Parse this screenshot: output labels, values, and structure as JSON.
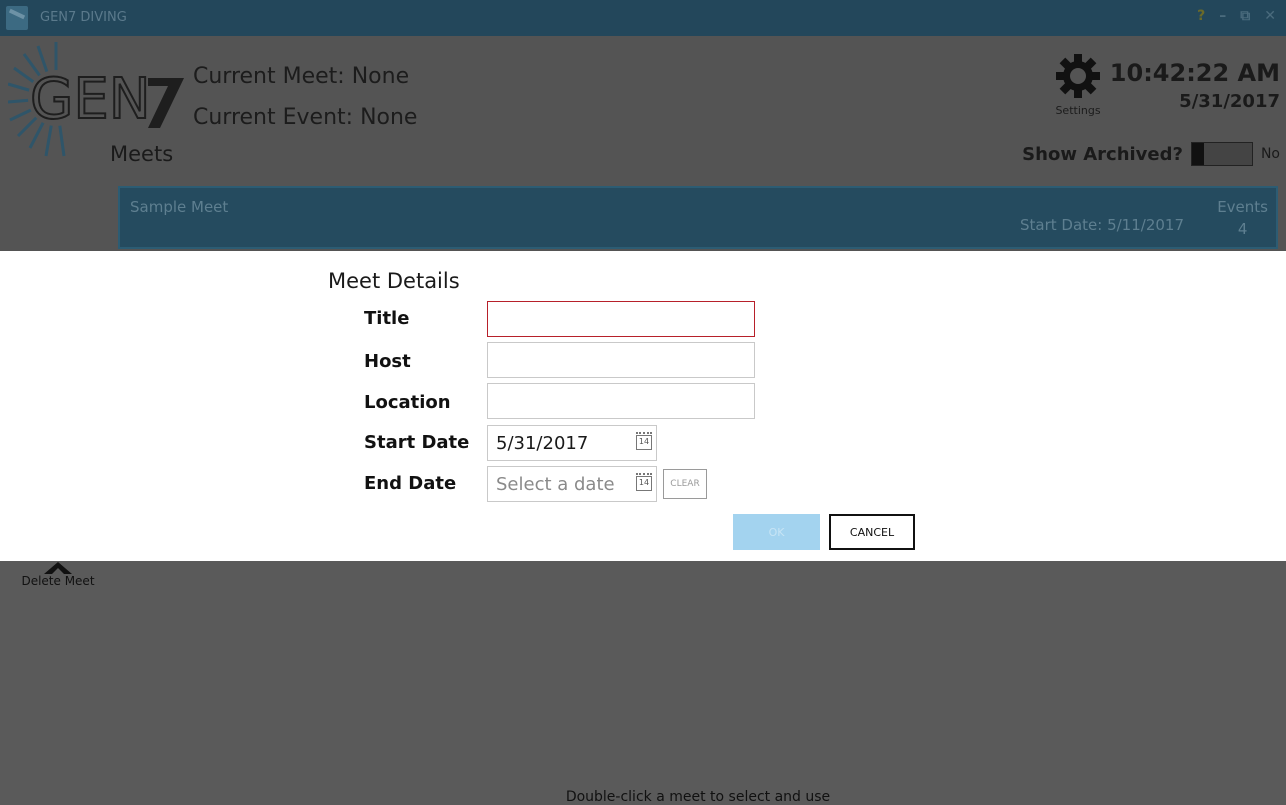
{
  "window": {
    "title": "GEN7 DIVING",
    "controls": {
      "help": "?",
      "minimize": "–",
      "restore": "⧉",
      "close": "✕"
    }
  },
  "header": {
    "current_meet_label": "Current Meet:",
    "current_meet_value": "None",
    "current_event_label": "Current Event:",
    "current_event_value": "None",
    "settings_label": "Settings",
    "time": "10:42:22 AM",
    "date": "5/31/2017"
  },
  "meets": {
    "section_title": "Meets",
    "show_archived_label": "Show Archived?",
    "show_archived_value": "No",
    "items": [
      {
        "name": "Sample Meet",
        "start_date": "Start Date: 5/11/2017",
        "events_label": "Events",
        "events_count": "4"
      }
    ]
  },
  "dialog": {
    "title": "Meet Details",
    "fields": {
      "title_label": "Title",
      "title_value": "",
      "host_label": "Host",
      "host_value": "",
      "location_label": "Location",
      "location_value": "",
      "start_date_label": "Start Date",
      "start_date_value": "5/31/2017",
      "end_date_label": "End Date",
      "end_date_placeholder": "Select a date",
      "calendar_icon_text": "14"
    },
    "clear_label": "CLEAR",
    "ok_label": "OK",
    "cancel_label": "CANCEL"
  },
  "actions": {
    "delete_meet_label": "Delete Meet"
  },
  "footer": {
    "hint": "Double-click a meet to select and use"
  },
  "colors": {
    "titlebar": "#23475b",
    "meet_card": "#254b5f",
    "overlay_gray": "#545454",
    "ok_button": "#a3d3ef",
    "invalid_border": "#b7202a"
  }
}
